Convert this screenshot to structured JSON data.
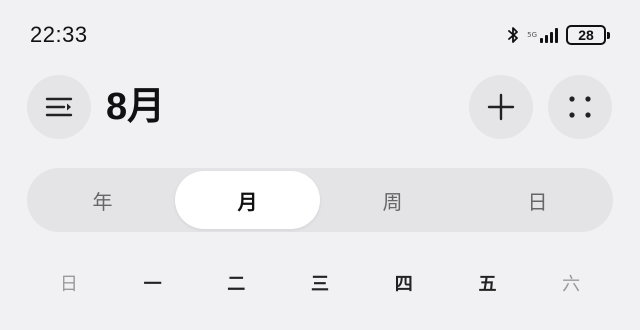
{
  "status_bar": {
    "time": "22:33",
    "network_label": "5G",
    "battery_level": "28",
    "signal_bars": 4
  },
  "header": {
    "month": "8月",
    "menu_icon": "menu-collapse-icon",
    "add_icon": "plus-icon",
    "more_icon": "four-dots-icon"
  },
  "view_switcher": {
    "options": [
      "年",
      "月",
      "周",
      "日"
    ],
    "selected": "月"
  },
  "weekdays": [
    "日",
    "一",
    "二",
    "三",
    "四",
    "五",
    "六"
  ],
  "colors": {
    "background": "#f1f1f3",
    "button_bg": "#e5e5e8",
    "segment_bg": "#e4e4e7",
    "active_segment": "#ffffff",
    "weekend_text": "#9a9a9e"
  }
}
